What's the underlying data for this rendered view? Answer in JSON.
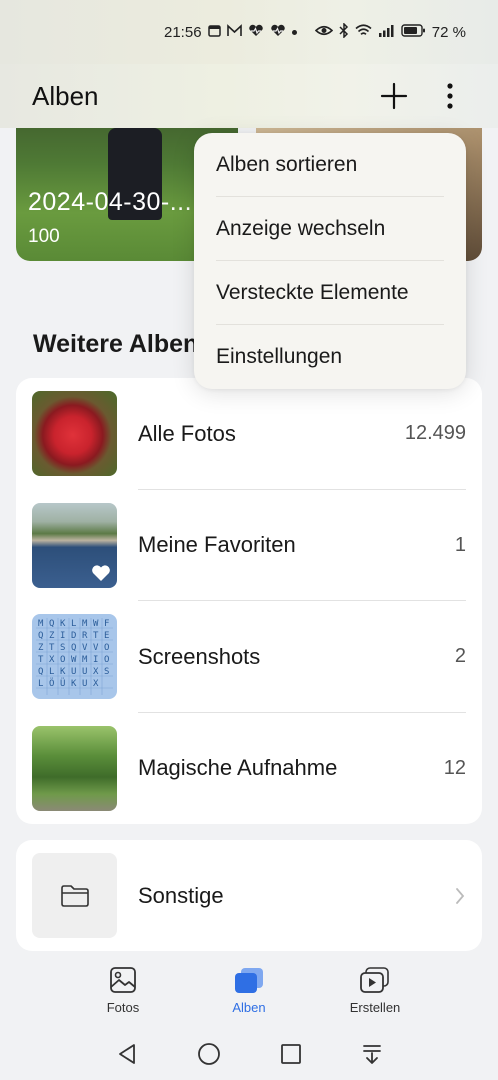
{
  "status_bar": {
    "time": "21:56",
    "battery": "72 %"
  },
  "header": {
    "title": "Alben"
  },
  "top_album": {
    "date": "2024-04-30-...",
    "count": "100"
  },
  "section": {
    "title": "Weitere Alben"
  },
  "albums": [
    {
      "label": "Alle Fotos",
      "count": "12.499"
    },
    {
      "label": "Meine Favoriten",
      "count": "1"
    },
    {
      "label": "Screenshots",
      "count": "2"
    },
    {
      "label": "Magische Aufnahme",
      "count": "12"
    }
  ],
  "other": {
    "label": "Sonstige"
  },
  "menu": {
    "items": [
      "Alben sortieren",
      "Anzeige wechseln",
      "Versteckte Elemente",
      "Einstellungen"
    ]
  },
  "bottom_nav": {
    "items": [
      {
        "label": "Fotos",
        "icon": "image-icon"
      },
      {
        "label": "Alben",
        "icon": "albums-icon",
        "active": true
      },
      {
        "label": "Erstellen",
        "icon": "create-icon"
      }
    ]
  },
  "colors": {
    "accent": "#2f6fe4"
  }
}
